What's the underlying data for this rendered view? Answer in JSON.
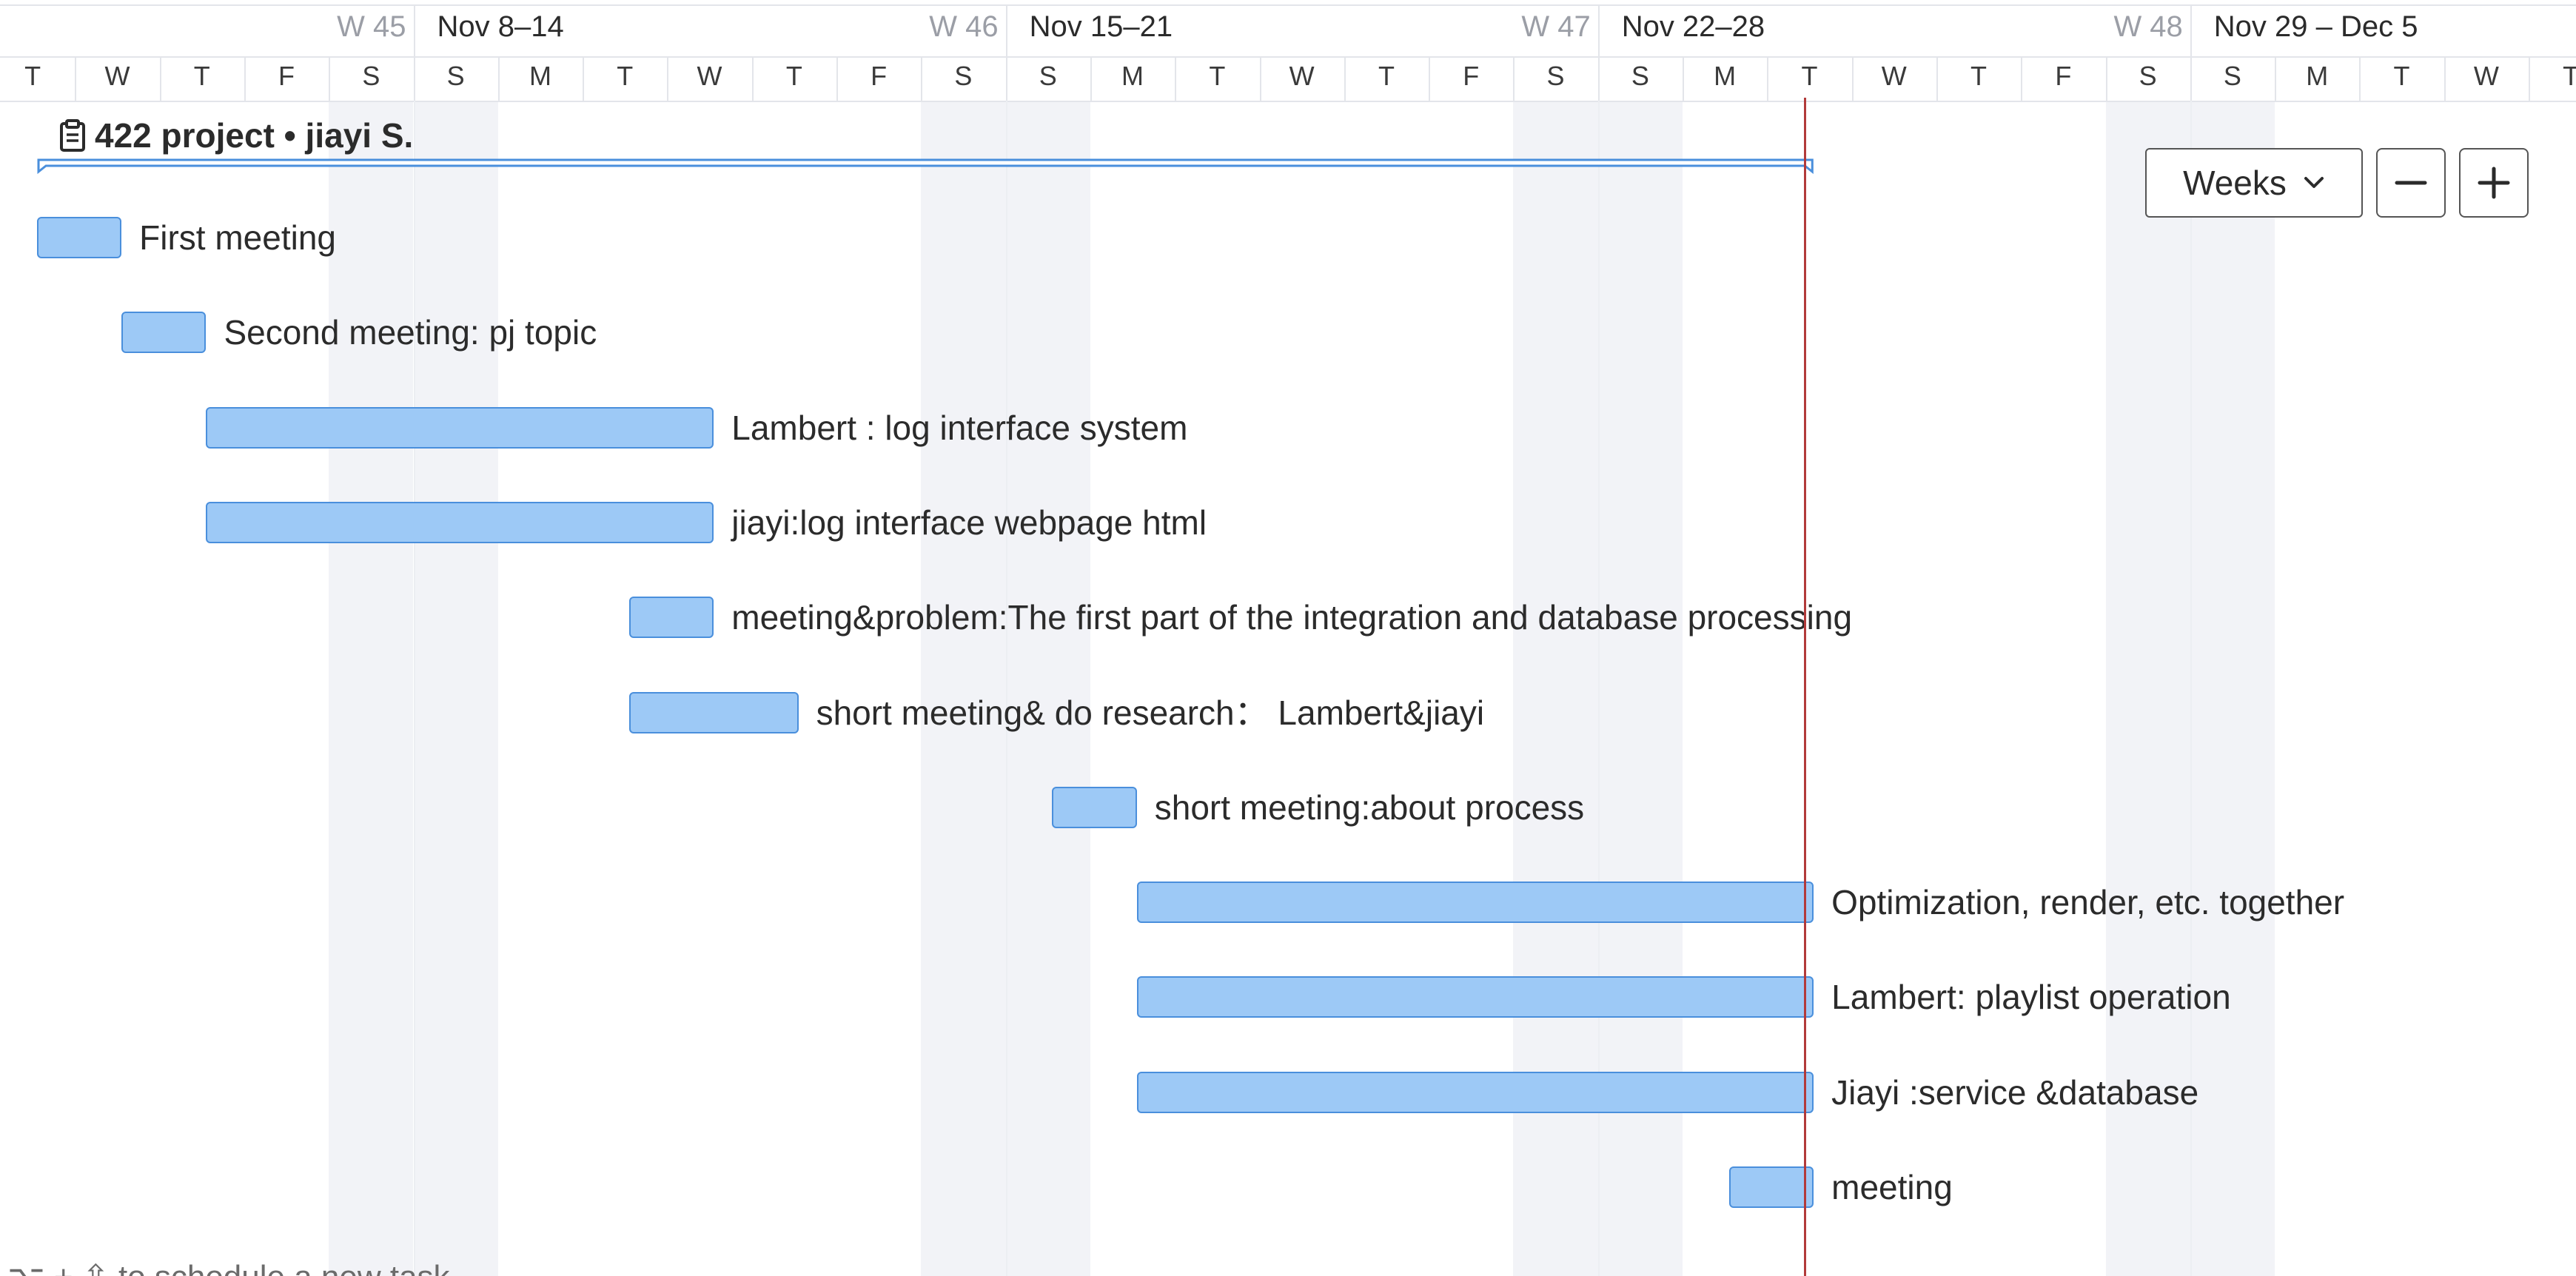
{
  "timeline": {
    "weeks": [
      {
        "num": "W 45",
        "range": "Nov 8–14"
      },
      {
        "num": "W 46",
        "range": "Nov 15–21"
      },
      {
        "num": "W 47",
        "range": "Nov 22–28"
      },
      {
        "num": "W 48",
        "range": "Nov 29 – Dec 5"
      }
    ],
    "days": [
      "T",
      "W",
      "T",
      "F",
      "S",
      "S",
      "M",
      "T",
      "W",
      "T",
      "F",
      "S",
      "S",
      "M",
      "T",
      "W",
      "T",
      "F",
      "S",
      "S",
      "M",
      "T",
      "W",
      "T",
      "F",
      "S",
      "S",
      "M",
      "T",
      "W",
      "T"
    ],
    "weekend_days": [
      4,
      5,
      11,
      12,
      18,
      19,
      25,
      26
    ],
    "today_day": 21
  },
  "project": {
    "title": "422 project • jiayi S.",
    "icon": "clipboard-icon",
    "start_day": 0.55,
    "end_day": 21.55
  },
  "tasks": [
    {
      "label": "First meeting",
      "start": 0.55,
      "end": 1.55
    },
    {
      "label": "Second meeting: pj topic",
      "start": 1.55,
      "end": 2.55
    },
    {
      "label": "Lambert : log interface system",
      "start": 2.55,
      "end": 8.55
    },
    {
      "label": "jiayi:log interface webpage html",
      "start": 2.55,
      "end": 8.55
    },
    {
      "label": "meeting&problem:The first part of the integration and database processing",
      "start": 7.55,
      "end": 8.55
    },
    {
      "label": "short meeting& do research： Lambert&jiayi",
      "start": 7.55,
      "end": 9.55
    },
    {
      "label": "short meeting:about process",
      "start": 12.55,
      "end": 13.55
    },
    {
      "label": "Optimization, render, etc. together",
      "start": 13.55,
      "end": 21.55
    },
    {
      "label": "Lambert: playlist operation",
      "start": 13.55,
      "end": 21.55
    },
    {
      "label": "Jiayi :service &database",
      "start": 13.55,
      "end": 21.55
    },
    {
      "label": "meeting",
      "start": 20.55,
      "end": 21.55
    }
  ],
  "controls": {
    "zoom_select": "Weeks",
    "zoom_out_icon": "minus-icon",
    "zoom_in_icon": "plus-icon"
  },
  "hint": "⌥ + ⇧ to schedule a new task",
  "colors": {
    "bar_fill": "#9dc9f6",
    "bar_border": "#4a8fdc",
    "today_line": "#b23a3a",
    "weekend_shade": "#f2f3f7"
  }
}
